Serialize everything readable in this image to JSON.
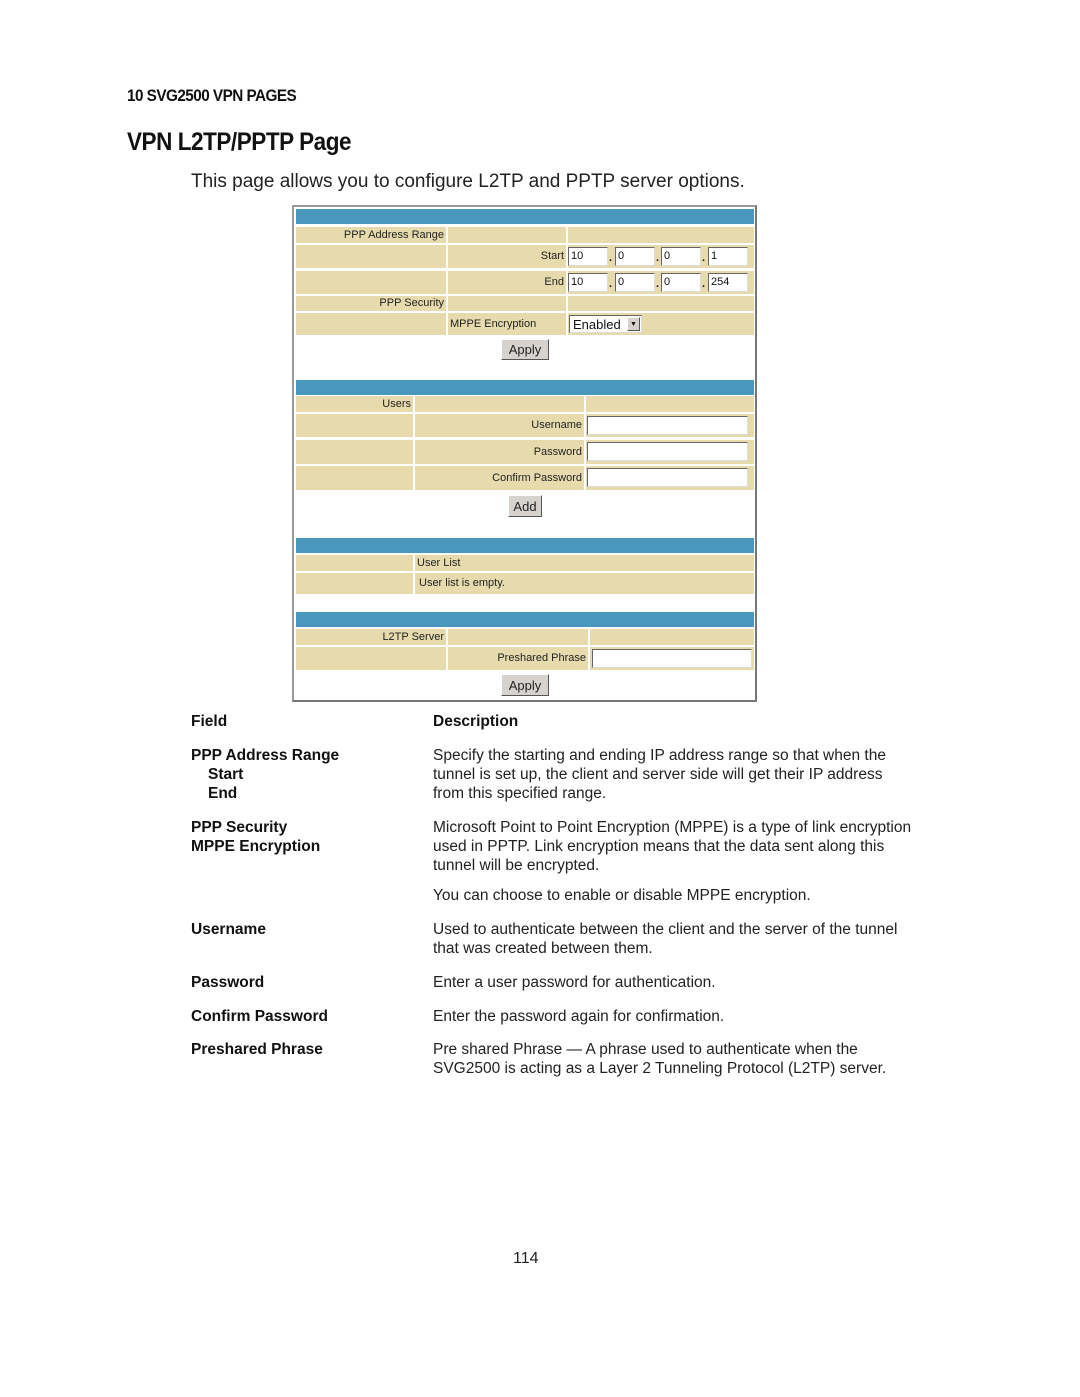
{
  "document": {
    "chapter_header": "10 SVG2500 VPN PAGES",
    "page_title": "VPN L2TP/PPTP Page",
    "intro": "This page allows you to configure L2TP and PPTP server options.",
    "page_number": "114"
  },
  "screenshot": {
    "ppp_address_range_label": "PPP Address Range",
    "start_label": "Start",
    "end_label": "End",
    "start_ip": [
      "10",
      "0",
      "0",
      "1"
    ],
    "end_ip": [
      "10",
      "0",
      "0",
      "254"
    ],
    "dot": ".",
    "ppp_security_label": "PPP Security",
    "mppe_label": "MPPE Encryption",
    "mppe_value": "Enabled",
    "apply_label": "Apply",
    "users_label": "Users",
    "username_label": "Username",
    "username_value": "",
    "password_label": "Password",
    "password_value": "",
    "confirm_password_label": "Confirm Password",
    "confirm_password_value": "",
    "add_label": "Add",
    "user_list_label": "User List",
    "user_list_empty": "User list is empty.",
    "l2tp_server_label": "L2TP Server",
    "preshared_phrase_label": "Preshared Phrase",
    "preshared_phrase_value": "",
    "colors": {
      "header_bar": "#4a97bd",
      "row_bg": "#e7dbae"
    }
  },
  "field_table": {
    "header_field": "Field",
    "header_description": "Description",
    "rows": [
      {
        "field": "PPP Address Range",
        "sub": [
          "Start",
          "End"
        ],
        "desc": [
          "Specify the starting and ending IP address range so that when the",
          "tunnel is set up, the client and server side will get their IP address",
          "from this specified range."
        ]
      },
      {
        "field": "PPP Security",
        "sub2": "MPPE Encryption",
        "desc": [
          "Microsoft Point to Point Encryption (MPPE) is a type of link encryption",
          "used in PPTP. Link encryption means that the data sent along this",
          "tunnel will be encrypted."
        ],
        "desc_extra": "You can choose to enable or disable MPPE encryption."
      },
      {
        "field": "Username",
        "desc": [
          "Used to authenticate between the client and the server of the tunnel",
          "that was created between them."
        ]
      },
      {
        "field": "Password",
        "desc": [
          "Enter a user password for authentication."
        ]
      },
      {
        "field": "Confirm Password",
        "desc": [
          "Enter the password again for confirmation."
        ]
      },
      {
        "field": "Preshared Phrase",
        "desc": [
          "Pre shared Phrase — A phrase used to authenticate when the",
          "SVG2500 is acting as a Layer 2 Tunneling Protocol (L2TP) server."
        ]
      }
    ]
  }
}
